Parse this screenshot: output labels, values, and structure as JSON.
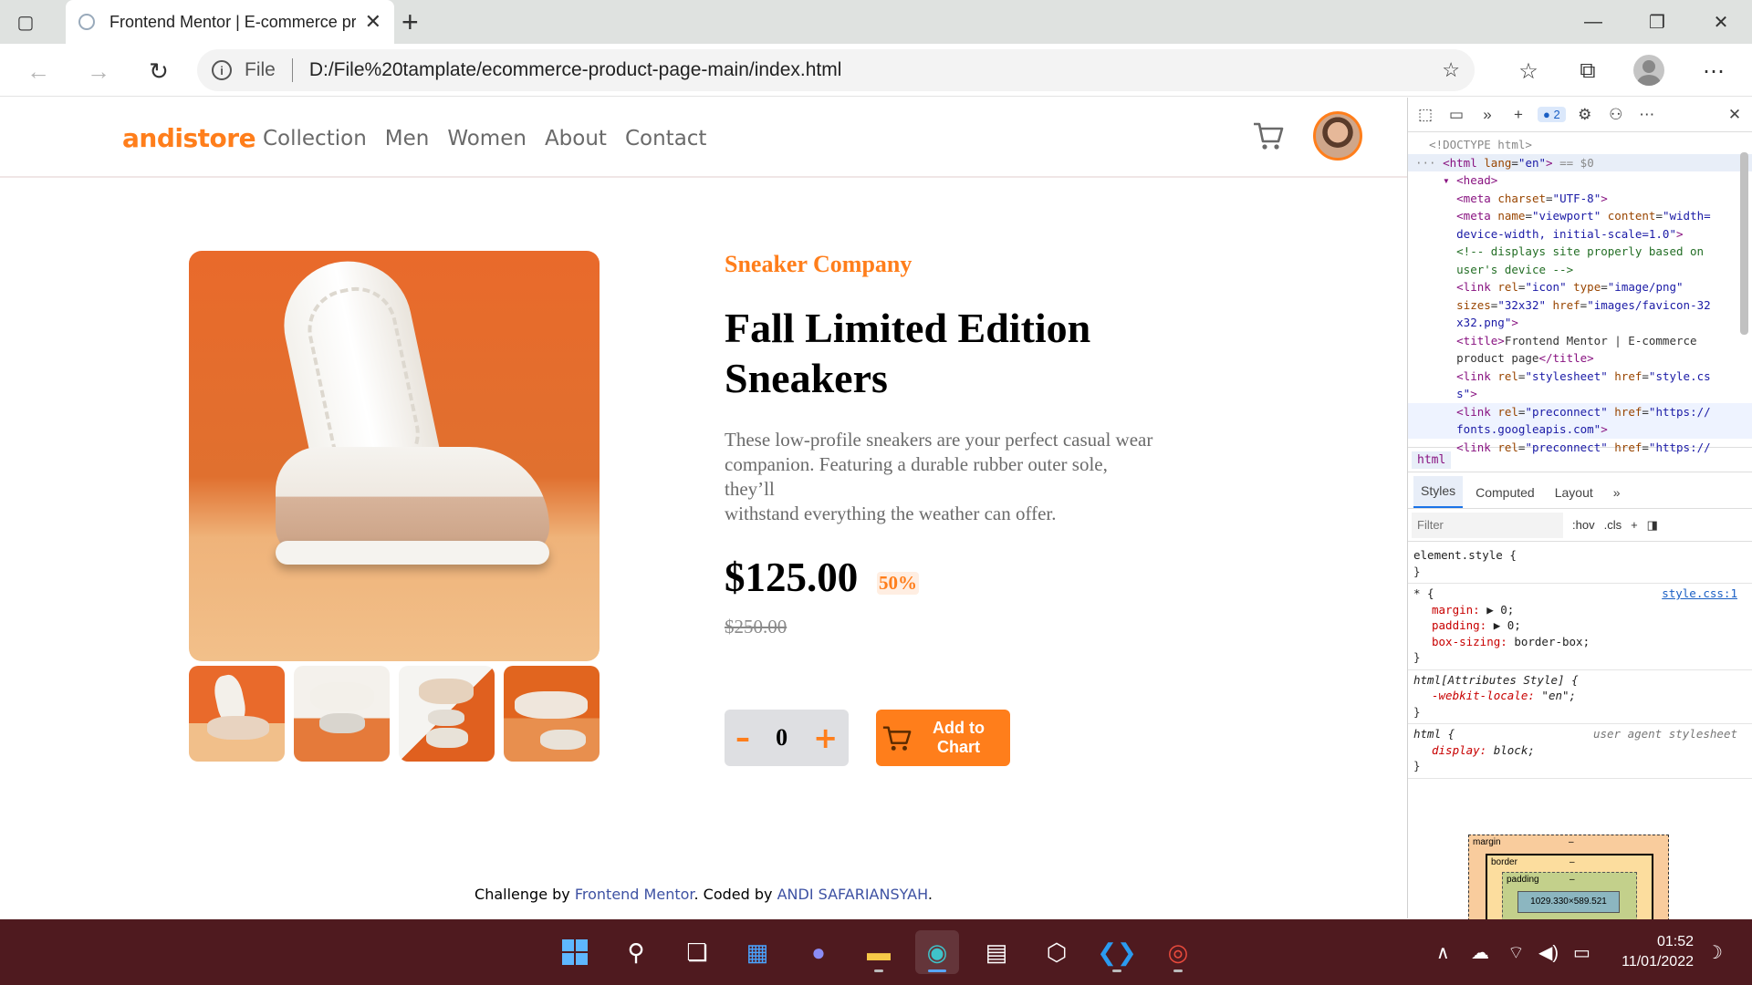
{
  "browser": {
    "tab_title": "Frontend Mentor | E-commerce product page",
    "address": {
      "scheme_label": "File",
      "url": "D:/File%20tamplate/ecommerce-product-page-main/index.html"
    }
  },
  "site": {
    "logo": "andistore",
    "nav": [
      "Collection",
      "Men",
      "Women",
      "About",
      "Contact"
    ],
    "accent_color": "#ff7e1b"
  },
  "product": {
    "company": "Sneaker Company",
    "title": "Fall Limited Edition Sneakers",
    "description": "These low-profile sneakers are your perfect casual wear\ncompanion. Featuring a durable rubber outer sole,\nthey’ll\nwithstand everything the weather can offer.",
    "price": "$125.00",
    "discount": "50%",
    "old_price": "$250.00",
    "quantity": "0",
    "minus_label": "–",
    "plus_label": "+",
    "add_button": "Add to Chart"
  },
  "footer": {
    "prefix": "Challenge by ",
    "link1": "Frontend Mentor",
    "middle": ". Coded by ",
    "link2": "ANDI SAFARIANSYAH",
    "suffix": "."
  },
  "devtools": {
    "issues_count": "2",
    "breadcrumb": "html",
    "tabs": [
      "Styles",
      "Computed",
      "Layout"
    ],
    "filter_placeholder": "Filter",
    "hov": ":hov",
    "cls": ".cls",
    "style_source": "style.css:1",
    "ua_source": "user agent stylesheet",
    "box_model": {
      "margin": "margin",
      "border": "border",
      "padding": "padding",
      "dash": "–",
      "content": "1029.330×589.521"
    }
  },
  "taskbar": {
    "time": "01:52",
    "date": "11/01/2022"
  }
}
